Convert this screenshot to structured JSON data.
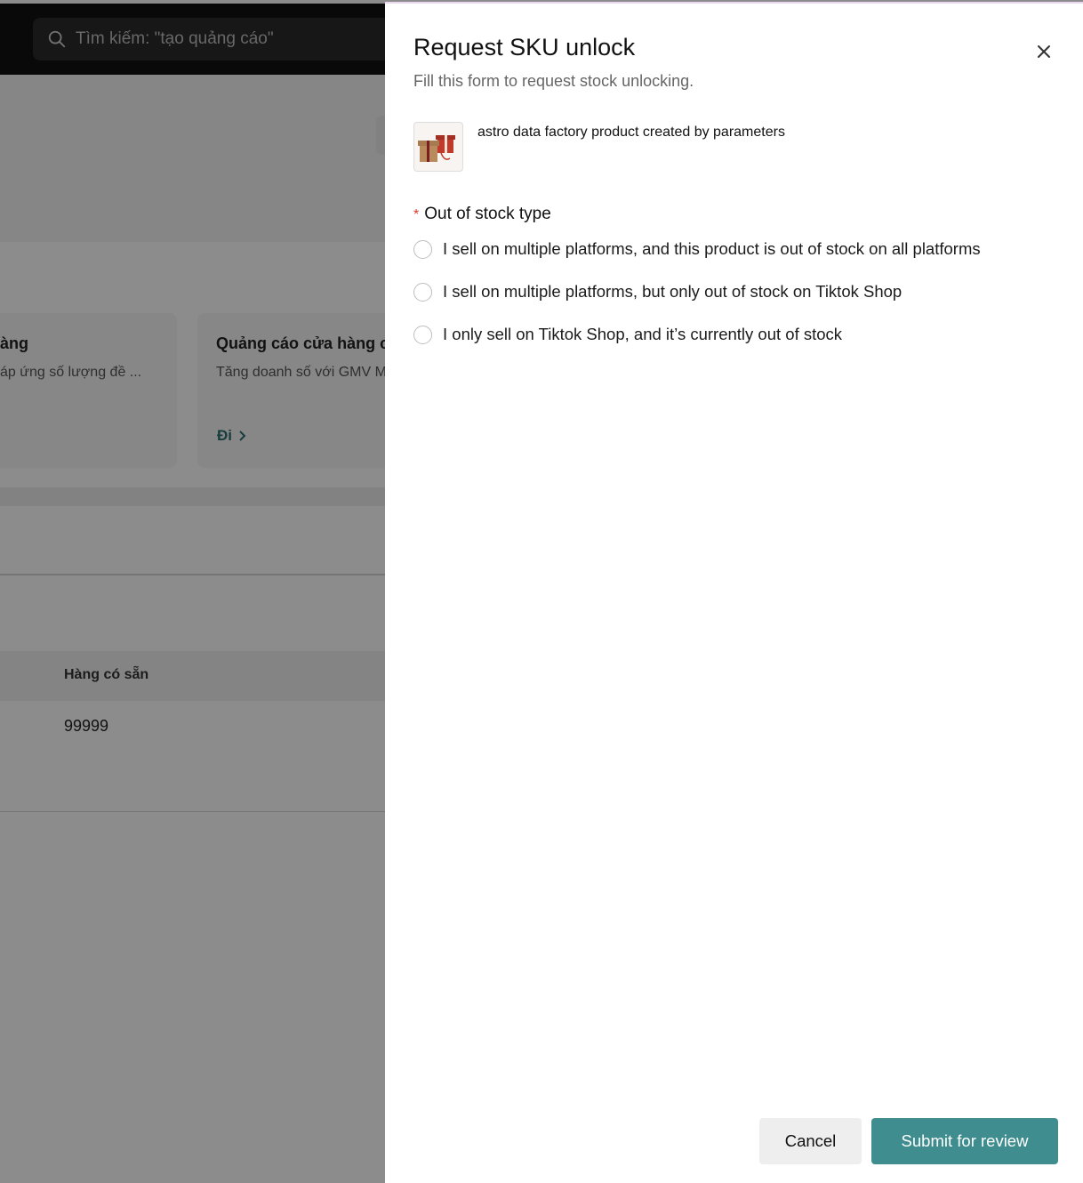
{
  "background": {
    "search": {
      "placeholder": "Tìm kiếm: \"tạo quảng cáo\""
    },
    "cards": [
      {
        "title": "àng",
        "desc": "áp ứng số lượng đề ..."
      },
      {
        "title": "Quảng cáo cửa hàng c",
        "desc": "Tăng doanh số với GMV M",
        "link": "Đi"
      }
    ],
    "table": {
      "header": "Hàng có sẵn",
      "value": "99999"
    }
  },
  "drawer": {
    "title": "Request SKU unlock",
    "subtitle": "Fill this form to request stock unlocking.",
    "product_name": "astro data factory product created by parameters",
    "field": {
      "required_mark": "*",
      "label": "Out of stock type"
    },
    "options": [
      "I sell on multiple platforms, and this product is out of stock on all platforms",
      "I sell on multiple platforms, but only out of stock on Tiktok Shop",
      "I only sell on Tiktok Shop, and it’s currently out of stock"
    ],
    "cancel_label": "Cancel",
    "submit_label": "Submit for review"
  },
  "colors": {
    "accent": "#3f8d8e",
    "required": "#e0392b",
    "link": "#2b6f70"
  },
  "icons": [
    "search-icon",
    "close-icon",
    "chevron-right-icon"
  ]
}
